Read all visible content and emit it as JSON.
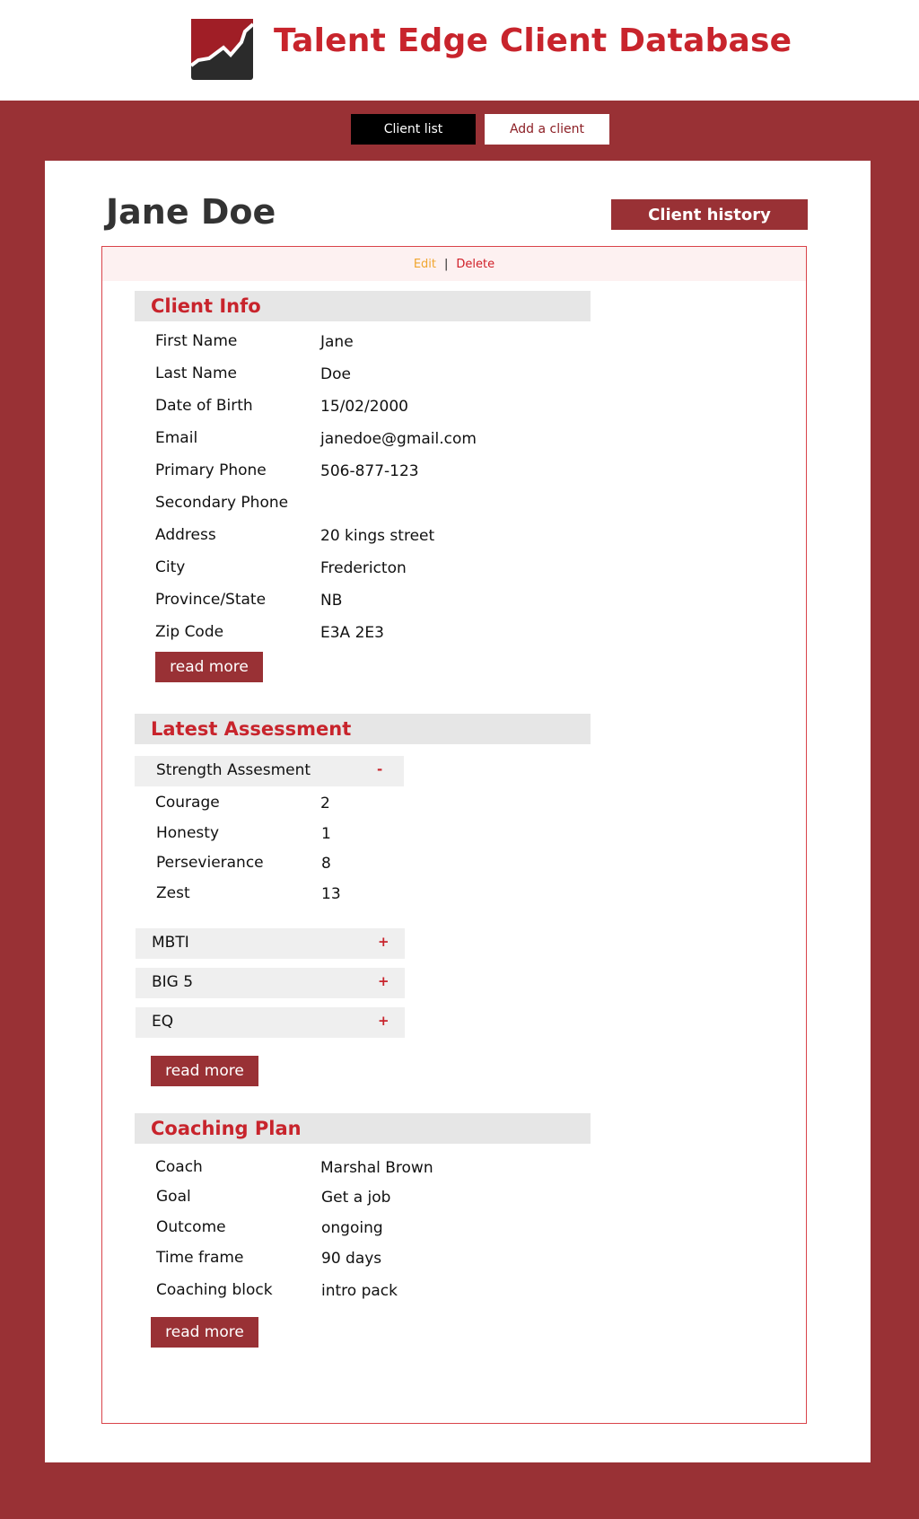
{
  "app": {
    "title": "Talent Edge Client Database"
  },
  "nav": {
    "client_list": "Client list",
    "add_client": "Add a client"
  },
  "client": {
    "name": "Jane Doe",
    "history_button": "Client history"
  },
  "actions": {
    "edit": "Edit",
    "separator": "|",
    "delete": "Delete"
  },
  "client_info": {
    "heading": "Client Info",
    "fields": [
      {
        "label": "First Name",
        "value": "Jane"
      },
      {
        "label": "Last Name",
        "value": "Doe"
      },
      {
        "label": "Date of Birth",
        "value": "15/02/2000"
      },
      {
        "label": "Email",
        "value": "janedoe@gmail.com"
      },
      {
        "label": "Primary Phone",
        "value": "506-877-123"
      },
      {
        "label": "Secondary Phone",
        "value": ""
      },
      {
        "label": "Address",
        "value": "20 kings street"
      },
      {
        "label": "City",
        "value": "Fredericton"
      },
      {
        "label": "Province/State",
        "value": "NB"
      },
      {
        "label": "Zip Code",
        "value": "E3A 2E3"
      }
    ],
    "read_more": "read more"
  },
  "assessment": {
    "heading": "Latest Assessment",
    "strength": {
      "label": "Strength Assesment",
      "toggle": "-",
      "items": [
        {
          "label": "Courage",
          "value": "2"
        },
        {
          "label": "Honesty",
          "value": "1"
        },
        {
          "label": "Persevierance",
          "value": "8"
        },
        {
          "label": "Zest",
          "value": "13"
        }
      ]
    },
    "collapsed": [
      {
        "label": "MBTI",
        "toggle": "+"
      },
      {
        "label": "BIG 5",
        "toggle": "+"
      },
      {
        "label": "EQ",
        "toggle": "+"
      }
    ],
    "read_more": "read more"
  },
  "coaching_plan": {
    "heading": "Coaching Plan",
    "fields": [
      {
        "label": "Coach",
        "value": "Marshal Brown"
      },
      {
        "label": "Goal",
        "value": "Get a job"
      },
      {
        "label": "Outcome",
        "value": "ongoing"
      },
      {
        "label": "Time frame",
        "value": "90 days"
      },
      {
        "label": "Coaching block",
        "value": "intro pack"
      }
    ],
    "read_more": "read more"
  },
  "colors": {
    "brand_red": "#c8242c",
    "band": "#993135",
    "edit_link": "#f0a62f"
  }
}
